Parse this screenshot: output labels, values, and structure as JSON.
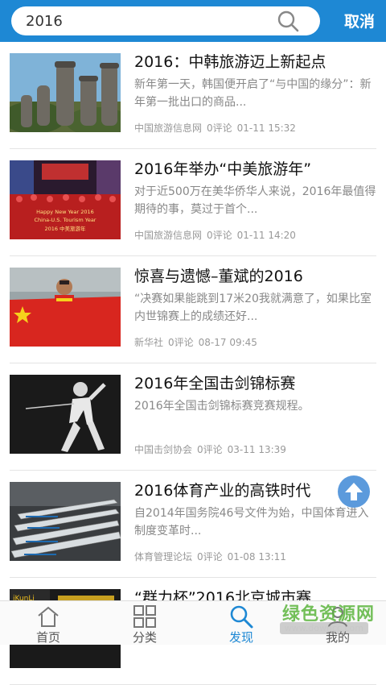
{
  "search": {
    "value": "2016",
    "cancel_label": "取消"
  },
  "articles": [
    {
      "title": "2016：中韩旅游迈上新起点",
      "desc": "新年第一天，韩国便开启了“与中国的缘分”：新年第一批出口的商品...",
      "source": "中国旅游信息网",
      "comments": "0评论",
      "time": "01-11 15:32",
      "image": "stone-statues-image"
    },
    {
      "title": "2016年举办“中美旅游年”",
      "desc": "对于近500万在美华侨华人来说，2016年最值得期待的事，莫过于首个...",
      "source": "中国旅游信息网",
      "comments": "0评论",
      "time": "01-11 14:20",
      "image": "times-square-banner-image",
      "banner_line1": "Happy New Year 2016",
      "banner_line2": "China-U.S. Tourism Year",
      "banner_line3": "2016 中美旅游年"
    },
    {
      "title": "惊喜与遗憾–董斌的2016",
      "desc": "“决赛如果能跳到17米20我就满意了，如果比室内世锦赛上的成绩还好...",
      "source": "新华社",
      "comments": "0评论",
      "time": "08-17 09:45",
      "image": "athlete-flag-image"
    },
    {
      "title": "2016年全国击剑锦标赛",
      "desc": "2016年全国击剑锦标赛竞赛规程。",
      "source": "中国击剑协会",
      "comments": "0评论",
      "time": "03-11 13:39",
      "image": "fencer-image"
    },
    {
      "title": "2016体育产业的高铁时代",
      "desc": "自2014年国务院46号文件为始，中国体育进入制度变革时...",
      "source": "体育管理论坛",
      "comments": "0评论",
      "time": "01-08 13:11",
      "image": "high-speed-trains-image"
    },
    {
      "title": "“群力杯”2016北京城市赛",
      "desc": "",
      "source": "",
      "comments": "",
      "time": "",
      "image": "event-stage-image",
      "image_text": "iKunLi"
    }
  ],
  "tabs": [
    {
      "label": "首页",
      "icon": "home-icon"
    },
    {
      "label": "分类",
      "icon": "grid-icon"
    },
    {
      "label": "发现",
      "icon": "search-icon",
      "active": true
    },
    {
      "label": "我的",
      "icon": "profile-icon"
    }
  ],
  "watermark": {
    "text": "绿色资源网",
    "url": "www.downcc.com"
  },
  "colors": {
    "header": "#1e88d4",
    "active_tab": "#1e88d4",
    "fab": "#4a90d9"
  }
}
